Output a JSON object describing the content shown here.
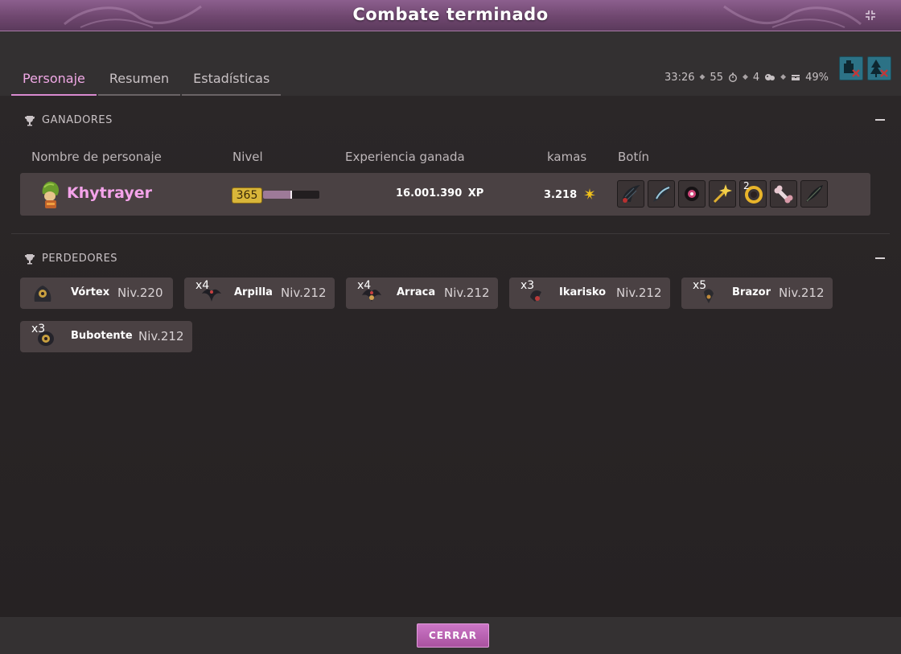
{
  "window": {
    "title": "Combate terminado"
  },
  "tabs": [
    {
      "label": "Personaje",
      "active": true
    },
    {
      "label": "Resumen",
      "active": false
    },
    {
      "label": "Estadísticas",
      "active": false
    }
  ],
  "stats": {
    "time": "33:26",
    "turns": "55",
    "rounds": "4",
    "percent": "49%"
  },
  "winners": {
    "header": "GANADORES",
    "columns": {
      "name": "Nombre de personaje",
      "level": "Nivel",
      "xp": "Experiencia ganada",
      "kamas": "kamas",
      "loot": "Botín"
    },
    "player": {
      "name": "Khytrayer",
      "level": "365",
      "xp_bar_fraction": 0.5,
      "xp_gained": "16.001.390",
      "xp_unit": "XP",
      "kamas": "3.218",
      "loot": [
        {
          "icon": "dark-wing-icon",
          "qty": ""
        },
        {
          "icon": "blade-icon",
          "qty": ""
        },
        {
          "icon": "eye-orb-icon",
          "qty": ""
        },
        {
          "icon": "golden-wand-icon",
          "qty": ""
        },
        {
          "icon": "gold-ring-icon",
          "qty": "2"
        },
        {
          "icon": "bone-icon",
          "qty": ""
        },
        {
          "icon": "feather-icon",
          "qty": ""
        }
      ]
    }
  },
  "losers": {
    "header": "PERDEDORES",
    "list": [
      {
        "qty": "",
        "name": "Vórtex",
        "level": "Niv.220"
      },
      {
        "qty": "x4",
        "name": "Arpilla",
        "level": "Niv.212"
      },
      {
        "qty": "x4",
        "name": "Arraca",
        "level": "Niv.212"
      },
      {
        "qty": "x3",
        "name": "Ikarisko",
        "level": "Niv.212"
      },
      {
        "qty": "x5",
        "name": "Brazor",
        "level": "Niv.212"
      },
      {
        "qty": "x3",
        "name": "Bubotente",
        "level": "Niv.212"
      }
    ]
  },
  "footer": {
    "close_label": "CERRAR"
  },
  "colors": {
    "accent": "#d98ad0",
    "player_name": "#f4a3ea",
    "row_bg": "#4a4143",
    "title_bar": "#7a4f7b"
  }
}
